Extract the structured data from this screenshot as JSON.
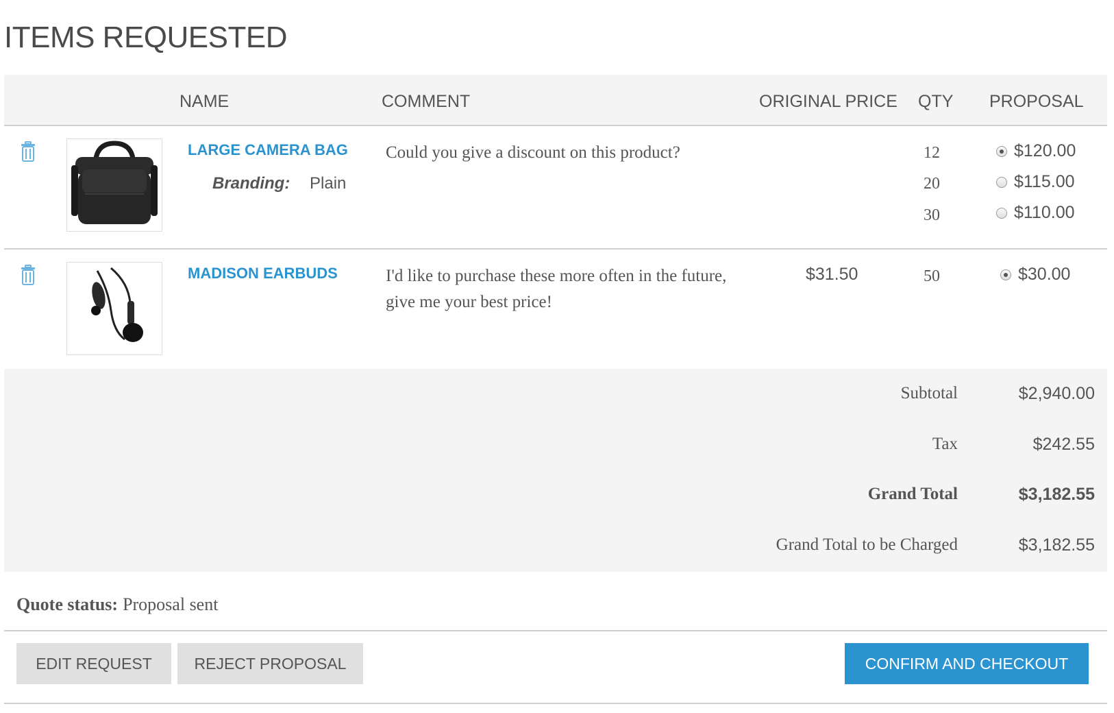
{
  "page": {
    "title": "ITEMS REQUESTED"
  },
  "table": {
    "headers": {
      "name": "NAME",
      "comment": "COMMENT",
      "original_price": "ORIGINAL PRICE",
      "qty": "QTY",
      "proposal": "PROPOSAL"
    },
    "rows": [
      {
        "name": "LARGE CAMERA BAG",
        "image_icon": "camera-bag-icon",
        "option_label": "Branding:",
        "option_value": "Plain",
        "comment": "Could you give a discount on this product?",
        "original_price": "",
        "tiers": [
          {
            "qty": "12",
            "price": "$120.00",
            "selected": true
          },
          {
            "qty": "20",
            "price": "$115.00",
            "selected": false
          },
          {
            "qty": "30",
            "price": "$110.00",
            "selected": false
          }
        ]
      },
      {
        "name": "MADISON EARBUDS",
        "image_icon": "earbuds-icon",
        "comment": "I'd like to purchase these more often in the future, give me your best price!",
        "original_price": "$31.50",
        "tiers": [
          {
            "qty": "50",
            "price": "$30.00",
            "selected": true
          }
        ]
      }
    ]
  },
  "totals": {
    "subtotal_label": "Subtotal",
    "subtotal_value": "$2,940.00",
    "tax_label": "Tax",
    "tax_value": "$242.55",
    "grand_total_label": "Grand Total",
    "grand_total_value": "$3,182.55",
    "charged_label": "Grand Total to be Charged",
    "charged_value": "$3,182.55"
  },
  "quote": {
    "status_label": "Quote status:",
    "status_value": "Proposal sent"
  },
  "actions": {
    "edit_label": "EDIT REQUEST",
    "reject_label": "REJECT PROPOSAL",
    "confirm_label": "CONFIRM AND CHECKOUT"
  },
  "colors": {
    "accent": "#2a93d0",
    "panel": "#f4f4f4",
    "text": "#555555"
  }
}
